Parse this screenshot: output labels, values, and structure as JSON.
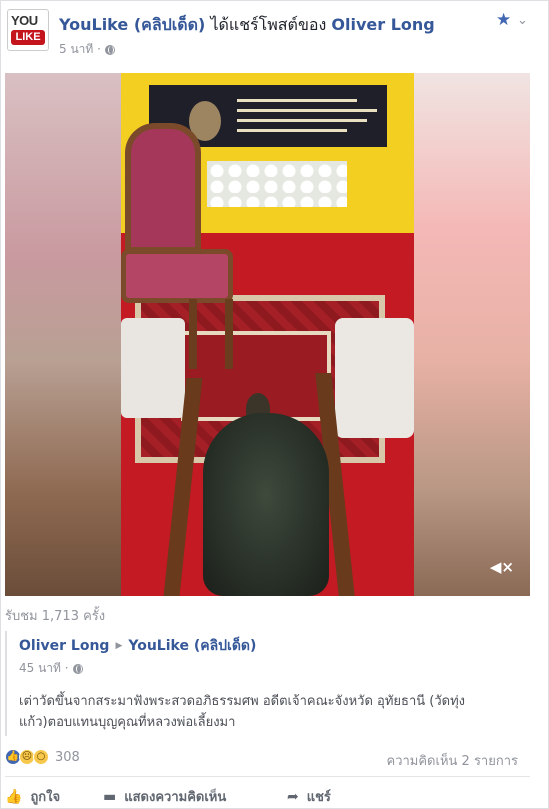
{
  "post": {
    "page_name": "YouLike (คลิปเด็ด)",
    "shared_text": " ได้แชร์โพสต์ของ ",
    "author": "Oliver Long",
    "time": "5 นาที ·",
    "avatar_top": "YOU",
    "avatar_bottom": "LIKE"
  },
  "video": {
    "views": "รับชม 1,713 ครั้ง",
    "mute_icon": "speaker-mute-icon"
  },
  "shared_post": {
    "author": "Oliver Long",
    "target": "YouLike (คลิปเด็ด)",
    "time": "45 นาที ·",
    "text": "เต่าวัดขึ้นจากสระมาฟังพระสวดอภิธรรมศพ อดีตเจ้าคณะจังหวัด อุทัยธานี (วัดทุ่งแก้ว)ตอบแทนบุญคุณที่หลวงพ่อเลี้ยงมา"
  },
  "reactions": {
    "count": "308",
    "comments": "ความคิดเห็น 2 รายการ"
  },
  "actions": {
    "like": "ถูกใจ",
    "comment": "แสดงความคิดเห็น",
    "share": "แชร์"
  },
  "colors": {
    "link": "#365899",
    "accent": "#4267b2",
    "muted": "#90949c"
  }
}
